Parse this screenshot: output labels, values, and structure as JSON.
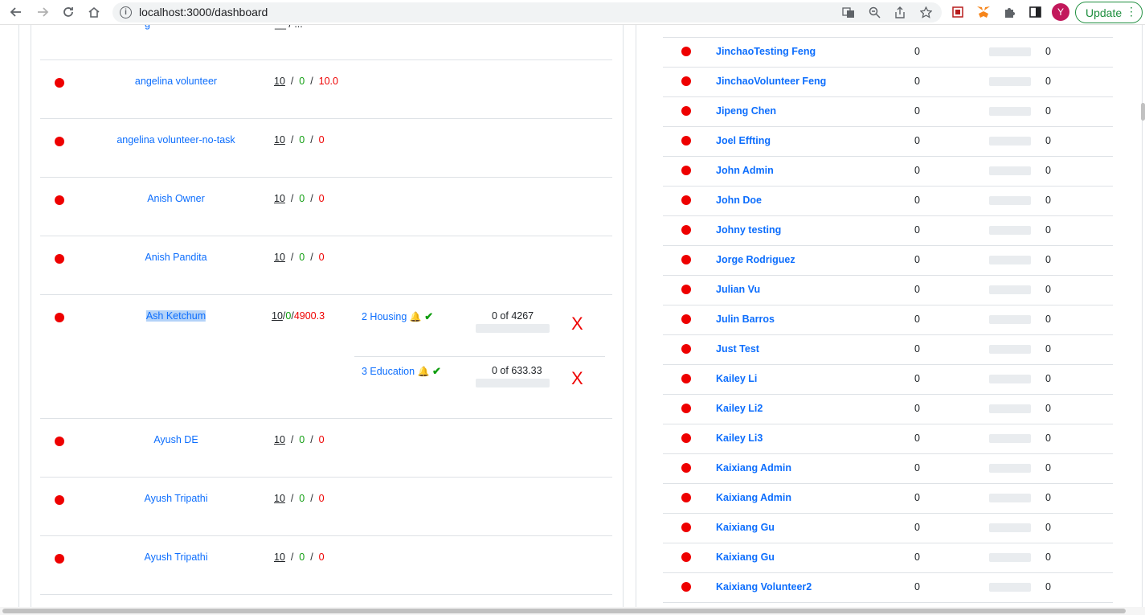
{
  "browser": {
    "url": "localhost:3000/dashboard",
    "info_icon": "i",
    "profile_initial": "Y",
    "update_label": "Update"
  },
  "left_table": {
    "separator": "/",
    "rows": [
      {
        "name": "angelina volunteer",
        "committed": "10",
        "logged": "0",
        "remaining": "10.0"
      },
      {
        "name": "angelina volunteer-no-task",
        "committed": "10",
        "logged": "0",
        "remaining": "0"
      },
      {
        "name": "Anish Owner",
        "committed": "10",
        "logged": "0",
        "remaining": "0"
      },
      {
        "name": "Anish Pandita",
        "committed": "10",
        "logged": "0",
        "remaining": "0"
      },
      {
        "name": "Ash Ketchum",
        "committed": "10",
        "logged": "0",
        "remaining": "4900.3",
        "tasks": [
          {
            "label": "2 Housing",
            "progress": "0 of 4267",
            "progress_fraction": 0,
            "remove": "X"
          },
          {
            "label": "3 Education",
            "progress": "0 of 633.33",
            "progress_fraction": 0,
            "remove": "X"
          }
        ]
      },
      {
        "name": "Ayush DE",
        "committed": "10",
        "logged": "0",
        "remaining": "0"
      },
      {
        "name": "Ayush Tripathi",
        "committed": "10",
        "logged": "0",
        "remaining": "0"
      },
      {
        "name": "Ayush Tripathi",
        "committed": "10",
        "logged": "0",
        "remaining": "0"
      }
    ]
  },
  "right_table": {
    "rows": [
      {
        "name": "JinchaoTesting Feng",
        "hours": "0",
        "total": "0"
      },
      {
        "name": "JinchaoVolunteer Feng",
        "hours": "0",
        "total": "0"
      },
      {
        "name": "Jipeng Chen",
        "hours": "0",
        "total": "0"
      },
      {
        "name": "Joel Effting",
        "hours": "0",
        "total": "0"
      },
      {
        "name": "John Admin",
        "hours": "0",
        "total": "0"
      },
      {
        "name": "John Doe",
        "hours": "0",
        "total": "0"
      },
      {
        "name": "Johny testing",
        "hours": "0",
        "total": "0"
      },
      {
        "name": "Jorge Rodriguez",
        "hours": "0",
        "total": "0"
      },
      {
        "name": "Julian Vu",
        "hours": "0",
        "total": "0"
      },
      {
        "name": "Julin Barros",
        "hours": "0",
        "total": "0"
      },
      {
        "name": "Just Test",
        "hours": "0",
        "total": "0"
      },
      {
        "name": "Kailey Li",
        "hours": "0",
        "total": "0"
      },
      {
        "name": "Kailey Li2",
        "hours": "0",
        "total": "0"
      },
      {
        "name": "Kailey Li3",
        "hours": "0",
        "total": "0"
      },
      {
        "name": "Kaixiang Admin",
        "hours": "0",
        "total": "0"
      },
      {
        "name": "Kaixiang Admin",
        "hours": "0",
        "total": "0"
      },
      {
        "name": "Kaixiang Gu",
        "hours": "0",
        "total": "0"
      },
      {
        "name": "Kaixiang Gu",
        "hours": "0",
        "total": "0"
      },
      {
        "name": "Kaixiang Volunteer2",
        "hours": "0",
        "total": "0"
      }
    ]
  },
  "colors": {
    "link": "#0d6efd",
    "status_dot": "#ee0000",
    "logged_green": "#0f9d0f",
    "remaining_red": "#ee0000"
  }
}
